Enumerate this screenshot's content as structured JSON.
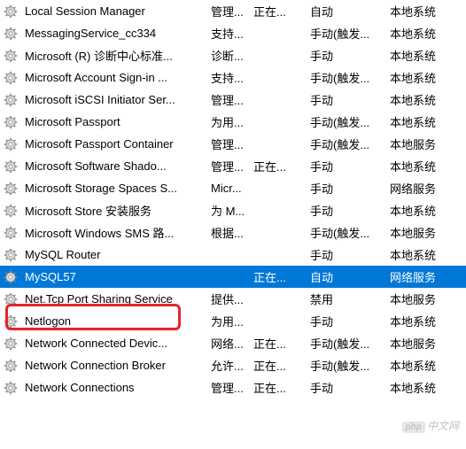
{
  "watermark": {
    "badge": "php",
    "text": "中文网"
  },
  "services": [
    {
      "name": "Local Session Manager",
      "description": "管理...",
      "status": "正在...",
      "startup": "自动",
      "logon": "本地系统",
      "selected": false
    },
    {
      "name": "MessagingService_cc334",
      "description": "支持...",
      "status": "",
      "startup": "手动(触发...",
      "logon": "本地系统",
      "selected": false
    },
    {
      "name": "Microsoft (R) 诊断中心标准...",
      "description": "诊断...",
      "status": "",
      "startup": "手动",
      "logon": "本地系统",
      "selected": false
    },
    {
      "name": "Microsoft Account Sign-in ...",
      "description": "支持...",
      "status": "",
      "startup": "手动(触发...",
      "logon": "本地系统",
      "selected": false
    },
    {
      "name": "Microsoft iSCSI Initiator Ser...",
      "description": "管理...",
      "status": "",
      "startup": "手动",
      "logon": "本地系统",
      "selected": false
    },
    {
      "name": "Microsoft Passport",
      "description": "为用...",
      "status": "",
      "startup": "手动(触发...",
      "logon": "本地系统",
      "selected": false
    },
    {
      "name": "Microsoft Passport Container",
      "description": "管理...",
      "status": "",
      "startup": "手动(触发...",
      "logon": "本地服务",
      "selected": false
    },
    {
      "name": "Microsoft Software Shado...",
      "description": "管理...",
      "status": "正在...",
      "startup": "手动",
      "logon": "本地系统",
      "selected": false
    },
    {
      "name": "Microsoft Storage Spaces S...",
      "description": "Micr...",
      "status": "",
      "startup": "手动",
      "logon": "网络服务",
      "selected": false
    },
    {
      "name": "Microsoft Store 安装服务",
      "description": "为 M...",
      "status": "",
      "startup": "手动",
      "logon": "本地系统",
      "selected": false
    },
    {
      "name": "Microsoft Windows SMS 路...",
      "description": "根据...",
      "status": "",
      "startup": "手动(触发...",
      "logon": "本地服务",
      "selected": false
    },
    {
      "name": "MySQL Router",
      "description": "",
      "status": "",
      "startup": "手动",
      "logon": "本地系统",
      "selected": false
    },
    {
      "name": "MySQL57",
      "description": "",
      "status": "正在...",
      "startup": "自动",
      "logon": "网络服务",
      "selected": true
    },
    {
      "name": "Net.Tcp Port Sharing Service",
      "description": "提供...",
      "status": "",
      "startup": "禁用",
      "logon": "本地服务",
      "selected": false
    },
    {
      "name": "Netlogon",
      "description": "为用...",
      "status": "",
      "startup": "手动",
      "logon": "本地系统",
      "selected": false
    },
    {
      "name": "Network Connected Devic...",
      "description": "网络...",
      "status": "正在...",
      "startup": "手动(触发...",
      "logon": "本地服务",
      "selected": false
    },
    {
      "name": "Network Connection Broker",
      "description": "允许...",
      "status": "正在...",
      "startup": "手动(触发...",
      "logon": "本地系统",
      "selected": false
    },
    {
      "name": "Network Connections",
      "description": "管理...",
      "status": "正在...",
      "startup": "手动",
      "logon": "本地系统",
      "selected": false
    }
  ]
}
